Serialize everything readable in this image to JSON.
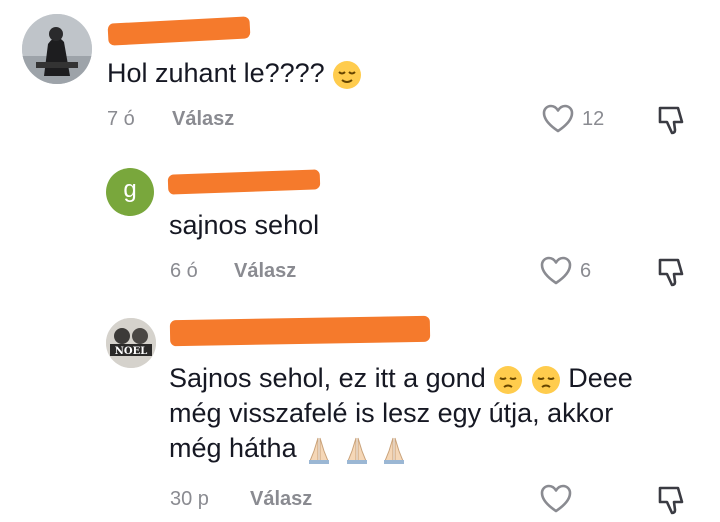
{
  "comments": [
    {
      "text": "Hol zuhant le????",
      "emojis": [
        "relieved-face"
      ],
      "time": "7 ó",
      "reply_label": "Válasz",
      "likes": "12"
    },
    {
      "avatar_letter": "g",
      "avatar_color": "#79a73c",
      "text": "sajnos sehol",
      "time": "6 ó",
      "reply_label": "Válasz",
      "likes": "6"
    },
    {
      "avatar_label": "NOEL",
      "text_line1": "Sajnos sehol, ez itt a gond",
      "text_line1_tail": "Deee",
      "text_line2": "még visszafelé is lesz egy útja, akkor",
      "text_line3": "még hátha",
      "emojis": [
        "pensive-face",
        "pensive-face",
        "folded-hands",
        "folded-hands",
        "folded-hands"
      ],
      "time": "30 p",
      "reply_label": "Válasz",
      "likes": ""
    }
  ],
  "colors": {
    "redaction": "#f57a2c",
    "meta": "#8a8b91",
    "text": "#161823"
  }
}
